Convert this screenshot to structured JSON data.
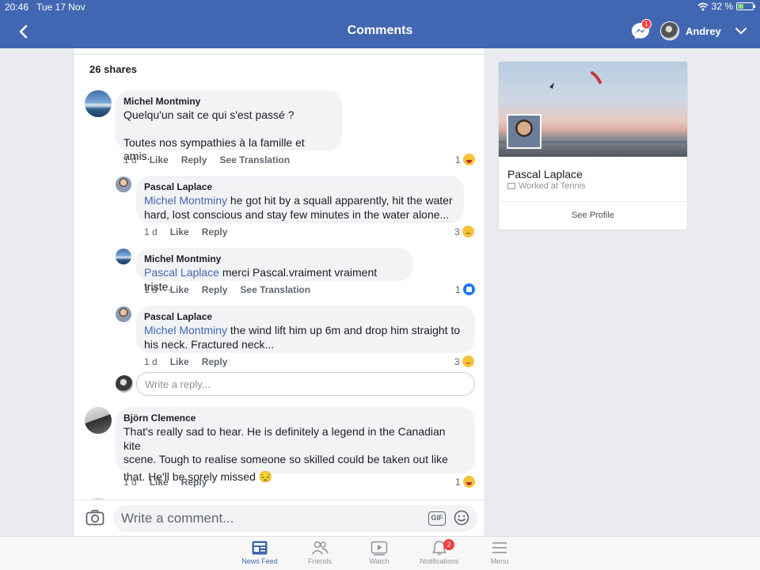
{
  "status_bar": {
    "time": "20:46",
    "date": "Tue 17 Nov",
    "battery": "32 %",
    "battery_level": 0.32
  },
  "header": {
    "title": "Comments",
    "messenger_badge": "1",
    "user_name": "Andrey"
  },
  "post": {
    "shares": "26 shares"
  },
  "comments": [
    {
      "author": "Michel Montminy",
      "lines": [
        "Quelqu'un sait ce qui s'est passé ?",
        "Toutes nos sympathies à la famille et amis."
      ],
      "time": "1 d",
      "like": "Like",
      "reply": "Reply",
      "translate": "See Translation",
      "reaction_count": "1",
      "reaction_type": "haha"
    },
    {
      "author": "Pascal Laplace",
      "mention": "Michel Montminy",
      "text_line1": " he got hit by a squall apparently, hit the water",
      "text_line2": "hard, lost conscious and stay few minutes in the water alone...",
      "time": "1 d",
      "like": "Like",
      "reply": "Reply",
      "reaction_count": "3",
      "reaction_type": "sad"
    },
    {
      "author": "Michel Montminy",
      "mention": "Pascal Laplace",
      "text": " merci Pascal.vraiment vraiment triste.",
      "time": "1 d",
      "like": "Like",
      "reply": "Reply",
      "translate": "See Translation",
      "reaction_count": "1",
      "reaction_type": "like"
    },
    {
      "author": "Pascal Laplace",
      "mention": "Michel Montminy",
      "text_line1": " the wind lift him up 6m and drop him straight to",
      "text_line2": "his neck. Fractured neck...",
      "time": "1 d",
      "like": "Like",
      "reply": "Reply",
      "reaction_count": "3",
      "reaction_type": "sad"
    },
    {
      "author": "Björn Clemence",
      "lines": [
        "That's really sad to hear. He is definitely a legend in the Canadian kite",
        "scene. Tough to realise someone so skilled could be taken out like",
        "that. He'll be sorely missed 😔"
      ],
      "time": "1 d",
      "like": "Like",
      "reply": "Reply",
      "reaction_count": "1",
      "reaction_type": "haha"
    }
  ],
  "reply_box": {
    "placeholder": "Write a reply..."
  },
  "composer": {
    "placeholder": "Write a comment...",
    "gif_label": "GIF"
  },
  "profile_card": {
    "name": "Pascal Laplace",
    "subtitle": "Worked at Tennis",
    "button": "See Profile"
  },
  "tabs": [
    {
      "label": "News Feed",
      "icon": "news-feed-icon",
      "active": true
    },
    {
      "label": "Friends",
      "icon": "friends-icon",
      "active": false
    },
    {
      "label": "Watch",
      "icon": "watch-icon",
      "active": false
    },
    {
      "label": "Notifications",
      "icon": "bell-icon",
      "active": false,
      "badge": "2"
    },
    {
      "label": "Menu",
      "icon": "hamburger-icon",
      "active": false
    }
  ],
  "colors": {
    "brand": "#4267b2",
    "mention": "#4267b2",
    "badge": "#fa3e3e",
    "bubble": "#f2f3f5"
  }
}
